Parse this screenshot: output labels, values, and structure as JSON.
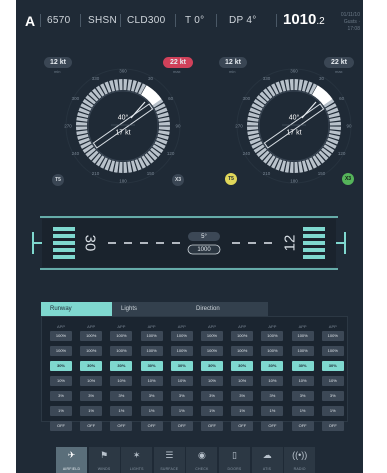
{
  "topbar": {
    "airport_letter": "A",
    "altitude": "6570",
    "station": "SHSN",
    "cloud": "CLD300",
    "temperature": "T 0°",
    "dewpoint": "DP 4°",
    "qnh_main": "1010",
    "qnh_decimal": ".2",
    "time_line1": "01/11/10",
    "time_line2": "Gusts · 17:08"
  },
  "wind_left": {
    "min_speed": "12 kt",
    "min_label": "min",
    "max_speed": "22 kt",
    "max_label": "max",
    "direction": "40°",
    "speed": "17 kt",
    "compass": [
      "360",
      "30",
      "60",
      "90",
      "120",
      "150",
      "180",
      "210",
      "240",
      "270",
      "300",
      "330"
    ],
    "left_badge": "T5",
    "right_badge": "X3"
  },
  "wind_right": {
    "min_speed": "12 kt",
    "min_label": "min",
    "max_speed": "22 kt",
    "max_label": "max",
    "direction": "40°",
    "speed": "17 kt",
    "compass": [
      "360",
      "30",
      "60",
      "90",
      "120",
      "150",
      "180",
      "210",
      "240",
      "270",
      "300",
      "330"
    ],
    "left_badge": "T5",
    "right_badge": "X3"
  },
  "runway": {
    "left_number": "30",
    "right_number": "12",
    "angle": "5°",
    "length": "1000"
  },
  "table": {
    "tabs": [
      "Runway",
      "Lights",
      "Direction"
    ],
    "header": "APP",
    "levels": [
      "100%",
      "100%",
      "30%",
      "10%",
      "3%",
      "1%",
      "OFF"
    ],
    "columns": 10,
    "selected_level_index": 2
  },
  "nav": [
    {
      "label": "AIRFIELD",
      "icon": "airplane-icon",
      "glyph": "✈",
      "active": true
    },
    {
      "label": "WINDS",
      "icon": "windsock-icon",
      "glyph": "⚑",
      "active": false
    },
    {
      "label": "LIGHTS",
      "icon": "lights-icon",
      "glyph": "✶",
      "active": false
    },
    {
      "label": "SURFACE",
      "icon": "surface-icon",
      "glyph": "☰",
      "active": false
    },
    {
      "label": "CHECK",
      "icon": "check-icon",
      "glyph": "◉",
      "active": false
    },
    {
      "label": "DOORS",
      "icon": "door-icon",
      "glyph": "▯",
      "active": false
    },
    {
      "label": "ATIS",
      "icon": "cloud-icon",
      "glyph": "☁",
      "active": false
    },
    {
      "label": "RADIO",
      "icon": "radio-icon",
      "glyph": "((•))",
      "active": false
    }
  ],
  "colors": {
    "background": "#1f2a36",
    "accent": "#7fd8cf",
    "max_wind_red": "#d0415a",
    "badge_yellow": "#e0d75a",
    "badge_green": "#55b45a"
  }
}
